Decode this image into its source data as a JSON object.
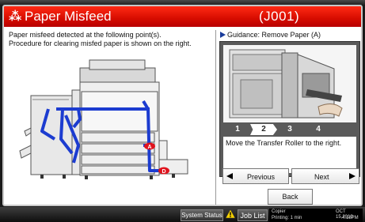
{
  "dialog": {
    "title": "Paper Misfeed",
    "code": "(J001)",
    "message_line1": "Paper misfeed detected at the following point(s).",
    "message_line2": "Procedure for clearing misfed paper is shown on the right.",
    "guidance_label": "Guidance: Remove Paper (A)",
    "steps": [
      "1",
      "2",
      "3",
      "4"
    ],
    "active_step": "2",
    "instruction": "Move the Transfer Roller to the right.",
    "prev_label": "Previous",
    "next_label": "Next",
    "back_label": "Back",
    "misfeed_points": [
      "A",
      "D"
    ]
  },
  "statusbar": {
    "system_status_label": "System Status",
    "job_list_label": "Job List",
    "device_label": "Copier",
    "device_status": "Printing: 1 min",
    "date": "OCT  15,2010",
    "time": "4:18PM"
  },
  "colors": {
    "title_red": "#e21800",
    "path_blue": "#1c3cd0",
    "marker_red": "#e0141e"
  },
  "icons": {
    "title_icon": "paper-misfeed-icon",
    "warning_icon": "warning-triangle-icon"
  }
}
